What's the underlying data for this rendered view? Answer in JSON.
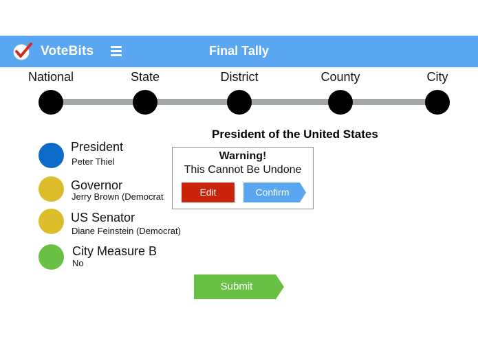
{
  "header": {
    "app_name": "VoteBits",
    "logo_icon": "checkmark-circle-icon",
    "menu_icon": "hamburger-menu-icon",
    "title": "Final Tally",
    "color": "#5aa6f0"
  },
  "timeline": {
    "stops": [
      "National",
      "State",
      "District",
      "County",
      "City"
    ]
  },
  "race_title": "President of the United States",
  "races": [
    {
      "name": "President",
      "choice": "Peter Thiel",
      "color": "#0b6bc6"
    },
    {
      "name": "Governor",
      "choice": "Jerry Brown  (Democrat",
      "color": "#dcbd2b"
    },
    {
      "name": "US Senator",
      "choice": "Diane Feinstein (Democrat)",
      "color": "#dcbd2b"
    },
    {
      "name": "City Measure B",
      "choice": "No",
      "color": "#6abf45"
    }
  ],
  "modal": {
    "title": "Warning!",
    "message": "This Cannot Be Undone",
    "edit_label": "Edit",
    "confirm_label": "Confirm",
    "edit_color": "#c9230c",
    "confirm_color": "#5aa6f0"
  },
  "submit_label": "Submit",
  "submit_color": "#6abf45"
}
